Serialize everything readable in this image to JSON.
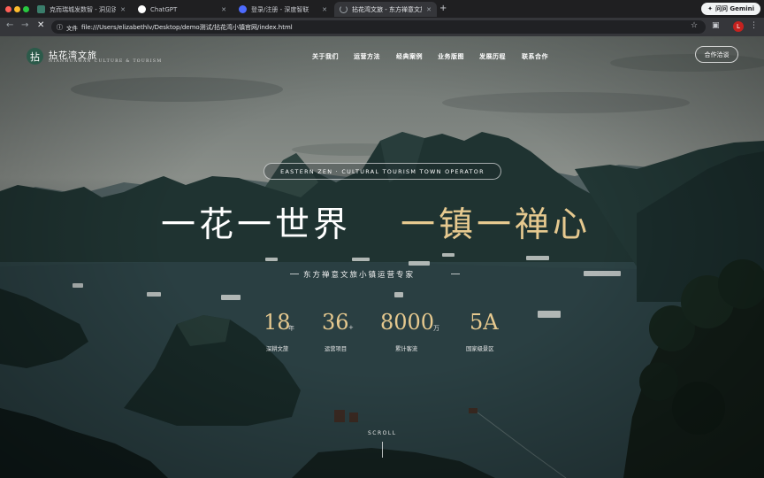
{
  "browser": {
    "tabs": [
      {
        "title": "克而瑞城发数智 - 洞见锐意全...",
        "favicon_color": "#3a7d6b",
        "active": false
      },
      {
        "title": "ChatGPT",
        "favicon_color": "#ffffff",
        "active": false
      },
      {
        "title": "登录/注册 - 深度智联",
        "favicon_color": "#4d6bfe",
        "active": false
      },
      {
        "title": "拈花湾文旅 - 东方禅意文旅小...",
        "favicon_color": "#9aa0a6",
        "active": true
      }
    ],
    "new_tab_label": "+",
    "gemini_label": "问问 Gemini",
    "address": {
      "info_label": "ⓘ",
      "scheme_label": "文件",
      "url": "file:///Users/elizabethlv/Desktop/demo测试/拈花湾小镇官网/index.html"
    },
    "profile_initial": "L"
  },
  "site": {
    "logo": {
      "mark": "拈",
      "name_cn": "拈花湾文旅",
      "name_en": "NIANHUAWAN CULTURE & TOURISM"
    },
    "nav": [
      "关于我们",
      "运营方法",
      "经典案例",
      "业务版图",
      "发展历程",
      "联系合作"
    ],
    "cta_label": "合作洽谈",
    "hero": {
      "pill": "EASTERN ZEN · CULTURAL TOURISM TOWN OPERATOR",
      "headline_white": "一花一世界",
      "headline_gold": "一镇一禅心",
      "tagline": "东方禅意文旅小镇运营专家",
      "stats": [
        {
          "value": "18",
          "unit": "年",
          "label": "深耕文旅"
        },
        {
          "value": "36",
          "unit": "+",
          "label": "运营项目"
        },
        {
          "value": "8000",
          "unit": "万",
          "label": "累计客流"
        },
        {
          "value": "5A",
          "unit": "",
          "label": "国家级景区"
        }
      ],
      "scroll_label": "SCROLL"
    }
  },
  "colors": {
    "gold": "#e6c98f",
    "logo_green": "#2c5a4a",
    "browser_bg": "#202124"
  }
}
